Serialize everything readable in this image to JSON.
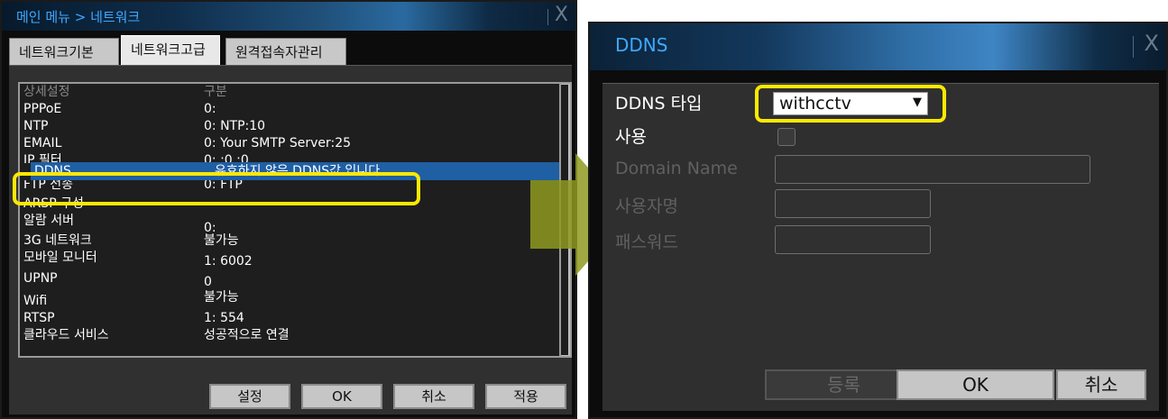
{
  "left_window": {
    "breadcrumb": "메인 메뉴 > 네트워크",
    "close_label": "X",
    "tabs": [
      {
        "label": "네트워크기본",
        "active": false
      },
      {
        "label": "네트워크고급",
        "active": true
      },
      {
        "label": "원격접속자관리",
        "active": false
      }
    ],
    "table": {
      "headers": [
        "상세설정",
        "구분"
      ],
      "rows": [
        {
          "setting": "PPPoE",
          "value": "0:"
        },
        {
          "setting": "NTP",
          "value": "0: NTP:10"
        },
        {
          "setting": "EMAIL",
          "value": "0: Your SMTP Server:25"
        },
        {
          "setting": "IP 필터",
          "value": "0: ;0 ;0"
        },
        {
          "setting": "DDNS",
          "value": "유효하지 않은 DDNS값 입니다.",
          "selected": true
        },
        {
          "setting": "FTP 전송",
          "value": "0: FTP"
        },
        {
          "setting": "ARSP 구성",
          "value": ""
        },
        {
          "setting": "알람 서버",
          "value": "0:"
        },
        {
          "setting": "3G 네트워크",
          "value": "불가능"
        },
        {
          "setting": "모바일 모니터",
          "value": "1: 6002"
        },
        {
          "setting": "UPNP",
          "value": "0"
        },
        {
          "setting": "Wifi",
          "value": "불가능"
        },
        {
          "setting": "RTSP",
          "value": "1: 554"
        },
        {
          "setting": "클라우드 서비스",
          "value": "성공적으로 연결"
        }
      ]
    },
    "buttons": {
      "settings": "설정",
      "ok": "OK",
      "cancel": "취소",
      "apply": "적용"
    }
  },
  "right_window": {
    "title": "DDNS",
    "close_label": "X",
    "labels": {
      "ddns_type": "DDNS 타입",
      "enable": "사용",
      "domain_name": "Domain Name",
      "username": "사용자명",
      "password": "패스워드"
    },
    "ddns_type_value": "withcctv",
    "enable_checked": false,
    "buttons": {
      "register": "등록",
      "ok": "OK",
      "cancel": "취소"
    }
  },
  "colors": {
    "highlight": "#ffe800",
    "selection": "#1f5fa4",
    "title_text": "#3fa9ff",
    "arrow": "#8f9a20"
  },
  "icons": {
    "arrow": "right-arrow-icon",
    "close": "close-icon",
    "dropdown": "dropdown-arrow-icon"
  }
}
